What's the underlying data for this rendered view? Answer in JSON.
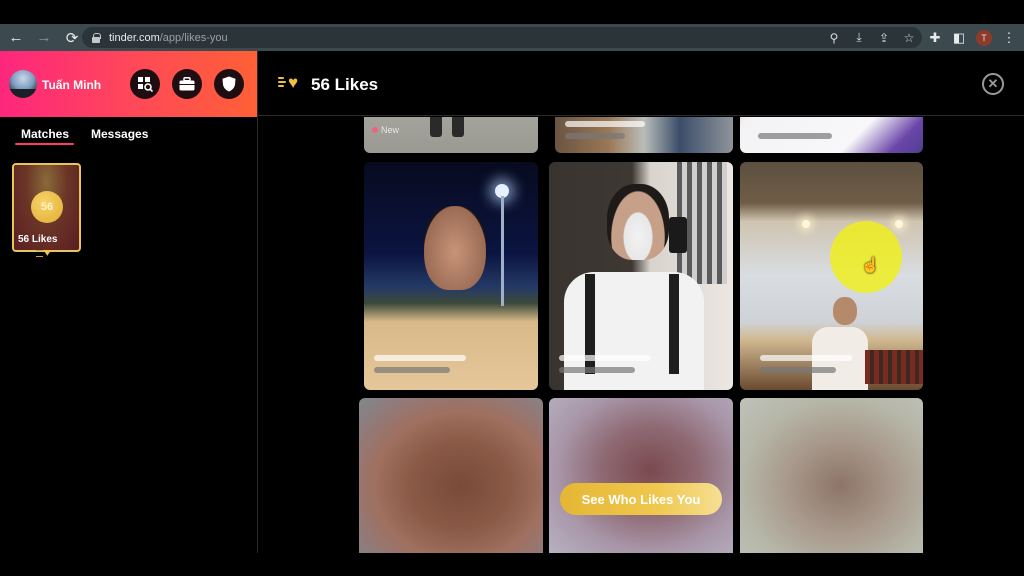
{
  "browser": {
    "url_host": "tinder.com",
    "url_path": "/app/likes-you",
    "profile_initial": "T",
    "nav": {
      "back_icon": "arrow-left",
      "forward_icon": "arrow-right",
      "reload_icon": "reload"
    },
    "omnibox_icons": [
      "location-pin-icon",
      "install-app-icon",
      "share-icon",
      "star-icon"
    ],
    "toolbar_icons": [
      "extensions-icon",
      "side-panel-icon",
      "profile-avatar",
      "menu-icon"
    ]
  },
  "sidebar": {
    "user_name": "Tuấn Minh",
    "header_buttons": [
      "explore-icon",
      "briefcase-icon",
      "shield-icon"
    ],
    "tabs": [
      {
        "label": "Matches",
        "active": true
      },
      {
        "label": "Messages",
        "active": false
      }
    ],
    "likes_card": {
      "count": "56",
      "label": "56 Likes"
    }
  },
  "main": {
    "title": "56 Likes",
    "close_icon": "close-circle-icon",
    "new_badge": "New",
    "cta_label": "See Who Likes You",
    "brand_gold": "#f0c13e",
    "brand_gradient_start": "#fd267d",
    "brand_gradient_end": "#ff6036"
  }
}
